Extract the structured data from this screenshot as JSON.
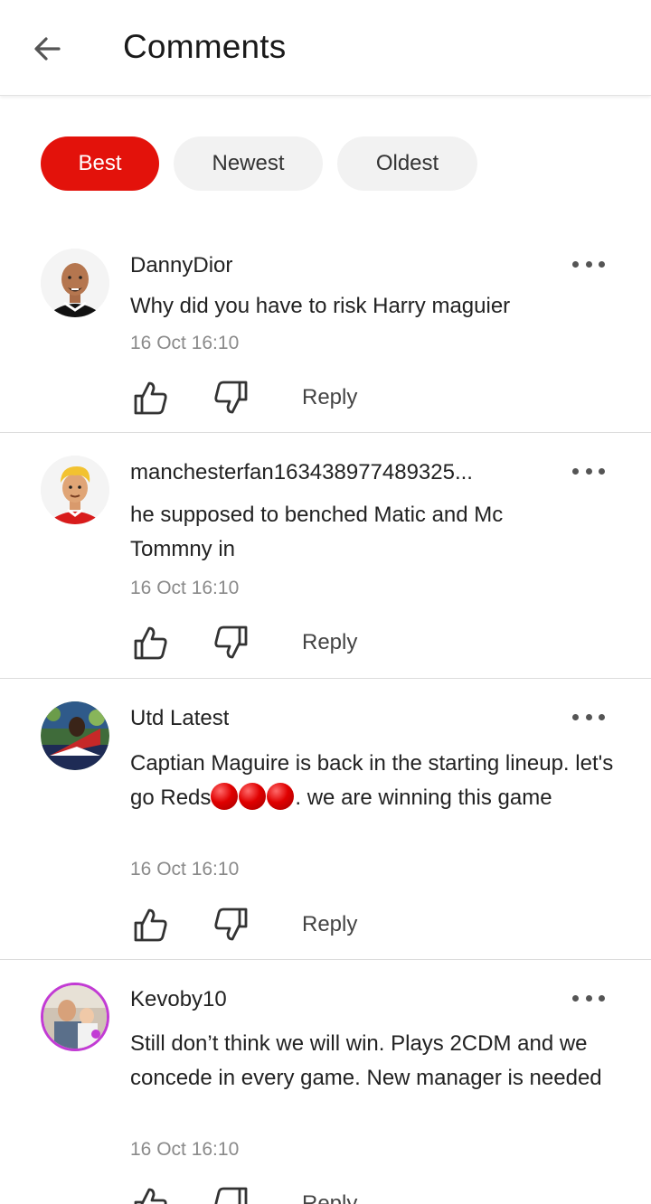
{
  "header": {
    "title": "Comments",
    "back_icon": "arrow-left-icon"
  },
  "filters": [
    {
      "label": "Best",
      "active": true
    },
    {
      "label": "Newest",
      "active": false
    },
    {
      "label": "Oldest",
      "active": false
    }
  ],
  "colors": {
    "accent": "#e3120b",
    "chip_bg": "#f2f2f2",
    "timestamp": "#8a8a8a"
  },
  "comments": [
    {
      "username": "DannyDior",
      "text": "Why did you have to risk Harry maguier",
      "time": "16 Oct 16:10",
      "reply": "Reply"
    },
    {
      "username": "manchesterfan163438977489325...",
      "text": "he supposed to benched Matic and Mc Tommny in",
      "time": "16 Oct 16:10",
      "reply": "Reply"
    },
    {
      "username": "Utd Latest",
      "text_pre": "Captian Maguire is back in the starting lineup. let's go Reds",
      "text_post": ". we are winning this game",
      "emoji": "red-circle x3",
      "time": "16 Oct 16:10",
      "reply": "Reply"
    },
    {
      "username": "Kevoby10",
      "text": "Still don’t think we will win. Plays 2CDM and we concede in every game. New manager is needed",
      "time": "16 Oct 16:10",
      "reply": "Reply"
    }
  ]
}
